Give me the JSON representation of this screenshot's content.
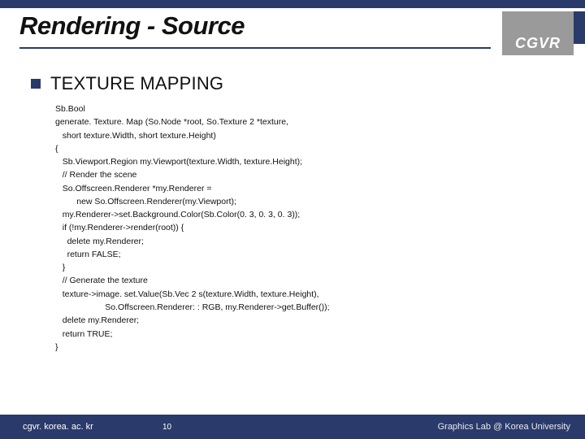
{
  "title": "Rendering - Source",
  "logo": "CGVR",
  "heading": "TEXTURE MAPPING",
  "code_lines": [
    "Sb.Bool",
    "generate. Texture. Map (So.Node *root, So.Texture 2 *texture,",
    "   short texture.Width, short texture.Height)",
    "{",
    "   Sb.Viewport.Region my.Viewport(texture.Width, texture.Height);",
    "   // Render the scene",
    "   So.Offscreen.Renderer *my.Renderer =",
    "         new So.Offscreen.Renderer(my.Viewport);",
    "   my.Renderer->set.Background.Color(Sb.Color(0. 3, 0. 3, 0. 3));",
    "   if (!my.Renderer->render(root)) {",
    "     delete my.Renderer;",
    "     return FALSE;",
    "   }",
    "   // Generate the texture",
    "   texture->image. set.Value(Sb.Vec 2 s(texture.Width, texture.Height),",
    "                     So.Offscreen.Renderer: : RGB, my.Renderer->get.Buffer());",
    "   delete my.Renderer;",
    "   return TRUE;",
    "}"
  ],
  "footer": {
    "left": "cgvr. korea. ac. kr",
    "page": "10",
    "right": "Graphics Lab @ Korea University"
  }
}
